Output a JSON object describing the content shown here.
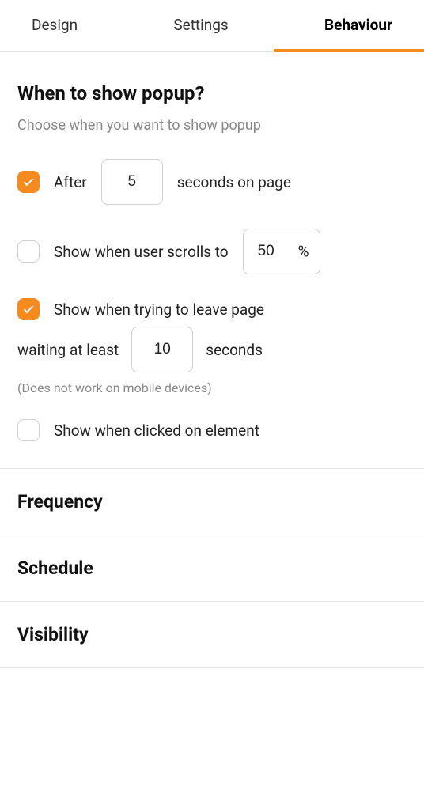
{
  "tabs": {
    "design": "Design",
    "settings": "Settings",
    "behaviour": "Behaviour"
  },
  "section": {
    "title": "When to show popup?",
    "desc": "Choose when you want to show popup"
  },
  "options": {
    "after": {
      "prefix": "After",
      "value": "5",
      "suffix": "seconds on page",
      "checked": true
    },
    "scroll": {
      "label": "Show when user scrolls to",
      "value": "50",
      "unit": "%",
      "checked": false
    },
    "leave": {
      "label": "Show when trying to leave page",
      "sub_prefix": "waiting at least",
      "value": "10",
      "sub_suffix": "seconds",
      "note": "(Does not work on mobile devices)",
      "checked": true
    },
    "click": {
      "label": "Show when clicked on element",
      "checked": false
    }
  },
  "collapsed": {
    "frequency": "Frequency",
    "schedule": "Schedule",
    "visibility": "Visibility"
  }
}
